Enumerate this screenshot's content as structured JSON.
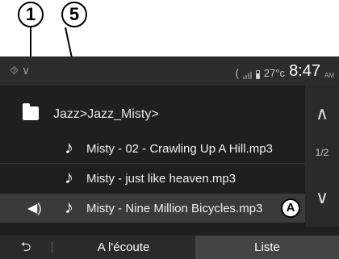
{
  "callouts": {
    "one": "1",
    "five": "5"
  },
  "status": {
    "left_icons": "⯑ ∨",
    "phone_glyph": "(",
    "temperature": "27°c",
    "time": "8:47",
    "ampm": "AM"
  },
  "breadcrumb": "Jazz>Jazz_Misty>",
  "tracks": [
    {
      "title": "Misty - 02 - Crawling Up A Hill.mp3",
      "playing": false
    },
    {
      "title": "Misty - just like heaven.mp3",
      "playing": false
    },
    {
      "title": "Misty - Nine Million Bicycles.mp3",
      "playing": true
    }
  ],
  "marker_a": "A",
  "pagination": "1/2",
  "bottom": {
    "back_glyph": "⮌",
    "tab_playing": "A l'écoute",
    "tab_list": "Liste"
  },
  "colors": {
    "screen_bg": "#1f1f1f",
    "active_row": "#3a3a3a",
    "active_tab": "#444444"
  },
  "icons": {
    "folder": "folder-up-icon",
    "note": "music-note-icon",
    "speaker": "speaker-icon"
  }
}
